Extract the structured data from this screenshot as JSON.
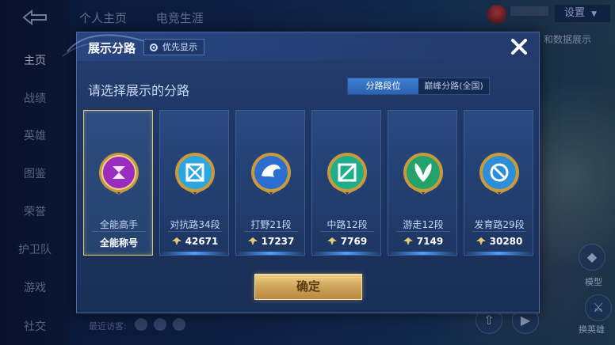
{
  "background": {
    "left_nav": [
      "主页",
      "战绩",
      "英雄",
      "图鉴",
      "荣誉",
      "护卫队",
      "游戏",
      "社交"
    ],
    "top_tabs": [
      "个人主页",
      "电竞生涯"
    ],
    "settings_label": "设置",
    "partial_text": "和数据展示",
    "right_labels": [
      "模型",
      "换英雄"
    ],
    "recent_visitors": "最近访客:"
  },
  "modal": {
    "title": "展示分路",
    "priority_label": "优先显示",
    "subtitle": "请选择展示的分路",
    "segments": [
      "分路段位",
      "巅峰分路(全国)"
    ],
    "cards": [
      {
        "title": "全能高手",
        "stat": "全能称号",
        "icon": "all-rounder-emblem",
        "selected": true,
        "color": "#9b2cc0"
      },
      {
        "title": "对抗路34段",
        "stat": "42671",
        "icon": "clash-lane-emblem",
        "selected": false,
        "color": "#2aa6e0"
      },
      {
        "title": "打野21段",
        "stat": "17237",
        "icon": "jungle-emblem",
        "selected": false,
        "color": "#2a6fd0"
      },
      {
        "title": "中路12段",
        "stat": "7769",
        "icon": "mid-lane-emblem",
        "selected": false,
        "color": "#1fae8a"
      },
      {
        "title": "游走12段",
        "stat": "7149",
        "icon": "roam-emblem",
        "selected": false,
        "color": "#23a36a"
      },
      {
        "title": "发育路29段",
        "stat": "30280",
        "icon": "farm-lane-emblem",
        "selected": false,
        "color": "#2a8fd8"
      }
    ],
    "confirm_label": "确定"
  },
  "colors": {
    "accent_gold": "#e0c46a",
    "segment_active": "#3f7fd0"
  }
}
